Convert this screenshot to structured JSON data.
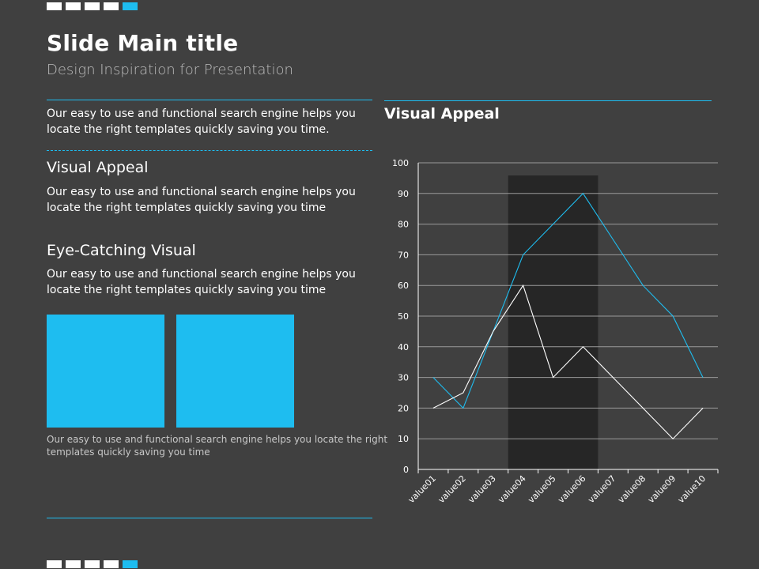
{
  "slide": {
    "title": "Slide Main title",
    "subtitle": "Design Inspiration for Presentation"
  },
  "left": {
    "intro": "Our easy to use and functional search engine helps you locate the right templates quickly saving you time.",
    "sections": [
      {
        "heading": "Visual Appeal",
        "body": "Our easy to use and functional search engine helps you locate the right templates quickly saving you time"
      },
      {
        "heading": "Eye-Catching Visual",
        "body": "Our easy to use and functional search engine helps you locate the right templates quickly saving you time"
      }
    ],
    "caption": "Our easy to use and functional search engine helps you locate the right templates quickly saving you time"
  },
  "colors": {
    "background": "#404040",
    "accent": "#1ebdf0",
    "text": "#ffffff",
    "highlight_band": "#262626"
  },
  "chart_data": {
    "type": "line",
    "title": "Visual Appeal",
    "categories": [
      "value01",
      "value02",
      "value03",
      "value04",
      "value05",
      "value06",
      "value07",
      "value08",
      "value09",
      "value10"
    ],
    "series": [
      {
        "color": "#1ebdf0",
        "values": [
          30,
          20,
          45,
          70,
          80,
          90,
          75,
          60,
          50,
          30
        ]
      },
      {
        "color": "#ffffff",
        "values": [
          20,
          25,
          45,
          60,
          30,
          40,
          30,
          20,
          10,
          20
        ]
      }
    ],
    "ylim": [
      0,
      100
    ],
    "yticks": [
      0,
      10,
      20,
      30,
      40,
      50,
      60,
      70,
      80,
      90,
      100
    ],
    "grid": true,
    "highlight_range": [
      "value04",
      "value06"
    ]
  }
}
